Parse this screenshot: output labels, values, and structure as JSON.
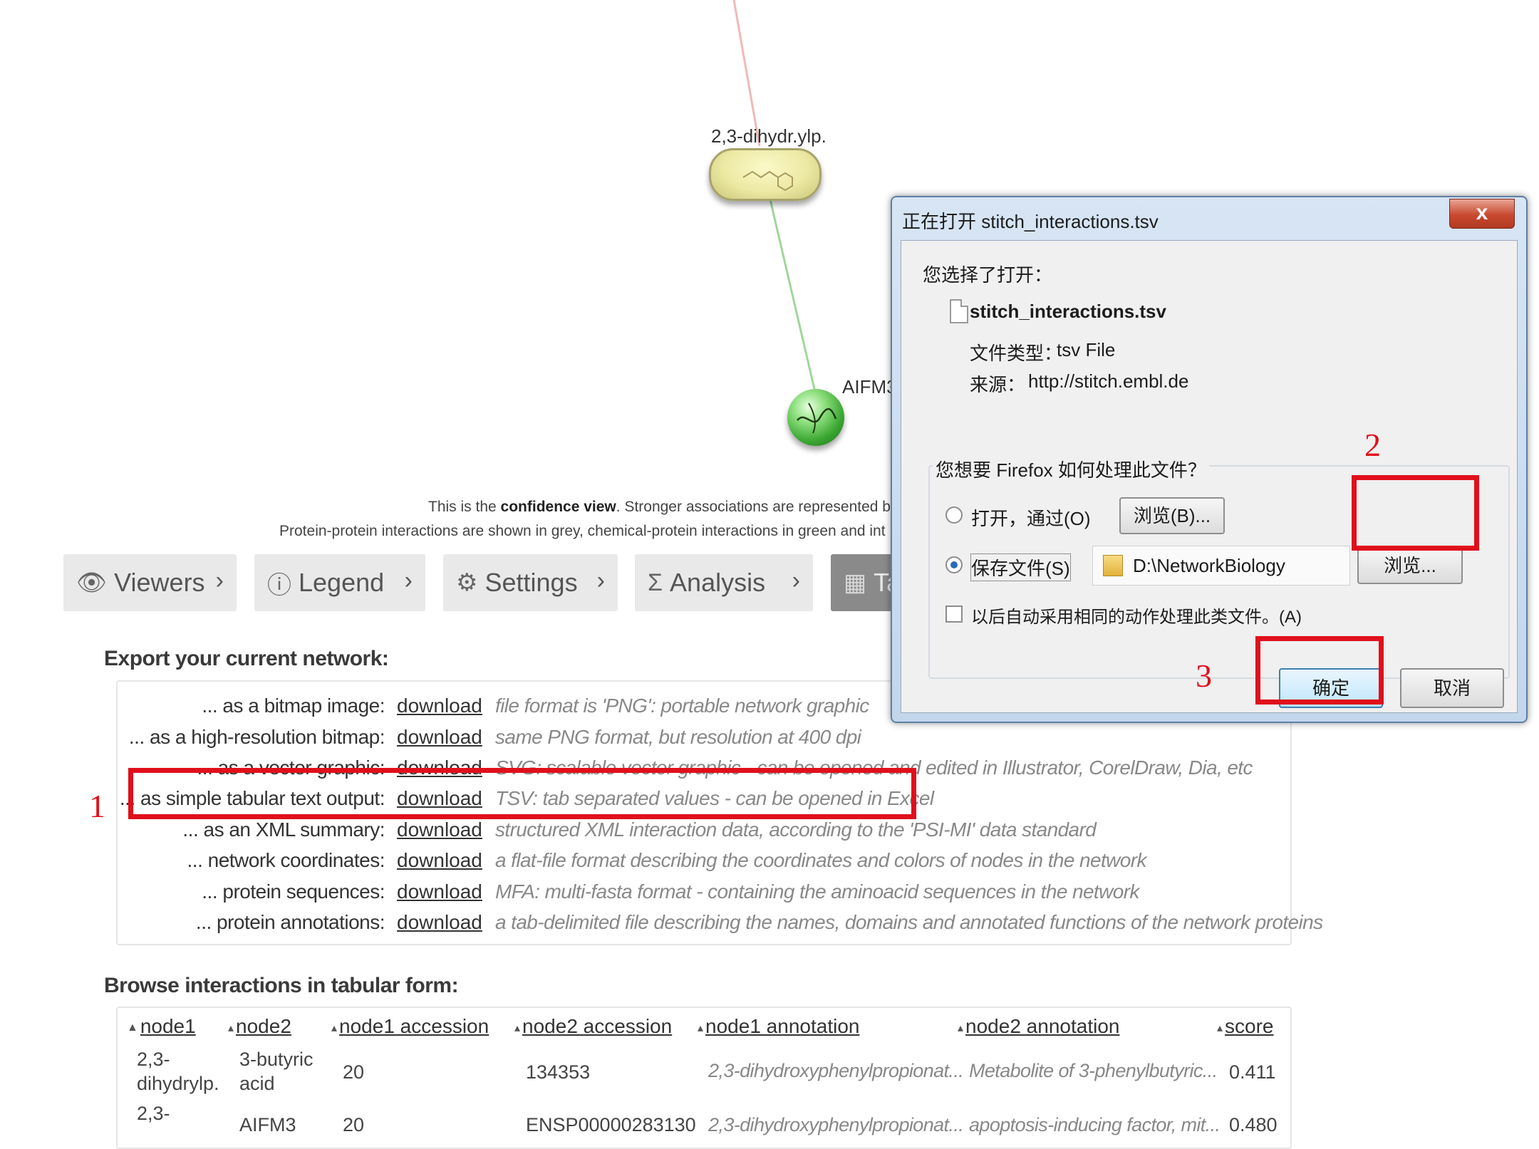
{
  "network": {
    "node_chem_label": "2,3-dihydr.ylp.",
    "node_protein_label": "AIFM3",
    "caption_line1_pre": "This is the ",
    "caption_line1_bold": "confidence view",
    "caption_line1_post": ". Stronger associations are represented by",
    "caption_line2": "Protein-protein interactions are shown in grey, chemical-protein interactions in green and int",
    "colors": {
      "edge_top": "#f2b8b8",
      "edge_green": "#9fd79a",
      "node_chem": "#ece9a3",
      "node_protein": "#3aa632"
    }
  },
  "tabs": [
    {
      "label": "Viewers",
      "icon": "eye-icon",
      "glyph": "👁"
    },
    {
      "label": "Legend",
      "icon": "info-icon",
      "glyph": "ⓘ"
    },
    {
      "label": "Settings",
      "icon": "gear-icon",
      "glyph": "⚙"
    },
    {
      "label": "Analysis",
      "icon": "sigma-icon",
      "glyph": "Σ"
    },
    {
      "label": "Ta",
      "icon": "table-icon",
      "glyph": "▦"
    }
  ],
  "export": {
    "heading": "Export your current network:",
    "link_text": "download",
    "rows": [
      {
        "label": "... as a bitmap image:",
        "desc": "file format is 'PNG': portable network graphic"
      },
      {
        "label": "... as a high-resolution bitmap:",
        "desc": "same PNG format, but resolution at 400 dpi"
      },
      {
        "label": "... as a vector graphic:",
        "desc": "SVG: scalable vector graphic - can be opened and edited in Illustrator, CorelDraw, Dia, etc"
      },
      {
        "label": "... as simple tabular text output:",
        "desc": "TSV: tab separated values - can be opened in Excel"
      },
      {
        "label": "... as an XML summary:",
        "desc": "structured XML interaction data, according to the 'PSI-MI' data standard"
      },
      {
        "label": "... network coordinates:",
        "desc": "a flat-file format describing the coordinates and colors of nodes in the network"
      },
      {
        "label": "... protein sequences:",
        "desc": "MFA: multi-fasta format - containing the aminoacid sequences in the network"
      },
      {
        "label": "... protein annotations:",
        "desc": "a tab-delimited file describing the names, domains and annotated functions of the network proteins"
      }
    ]
  },
  "browse": {
    "heading": "Browse interactions in tabular form:",
    "columns": [
      "node1",
      "node2",
      "node1 accession",
      "node2 accession",
      "node1 annotation",
      "node2 annotation",
      "score"
    ],
    "rows": [
      {
        "node1": "2,3-\ndihydrylp.",
        "node2": "3-butyric\nacid",
        "acc1": "20",
        "acc2": "134353",
        "ann1": "2,3-dihydroxyphenylpropionat...",
        "ann2": "Metabolite of 3-phenylbutyric...",
        "score": "0.411"
      },
      {
        "node1": "2,3-",
        "node2": "AIFM3",
        "acc1": "20",
        "acc2": "ENSP00000283130",
        "ann1": "2,3-dihydroxyphenylpropionat...",
        "ann2": "apoptosis-inducing factor, mit...",
        "score": "0.480"
      }
    ]
  },
  "annotations": {
    "num1": "1",
    "num2": "2",
    "num3": "3",
    "color": "#e0101b"
  },
  "dialog": {
    "title": "正在打开 stitch_interactions.tsv",
    "close": "x",
    "chosen_label": "您选择了打开：",
    "filename": "stitch_interactions.tsv",
    "type_label": "文件类型：",
    "type_value": "tsv File",
    "source_label": "来源：",
    "source_value": "http://stitch.embl.de",
    "question": "您想要 Firefox 如何处理此文件？",
    "open_with": "打开，通过(O)",
    "browse_b": "浏览(B)...",
    "save_file": "保存文件(S)",
    "save_path": "D:\\NetworkBiology",
    "browse2": "浏览...",
    "auto": "以后自动采用相同的动作处理此类文件。(A)",
    "ok": "确定",
    "cancel": "取消"
  }
}
